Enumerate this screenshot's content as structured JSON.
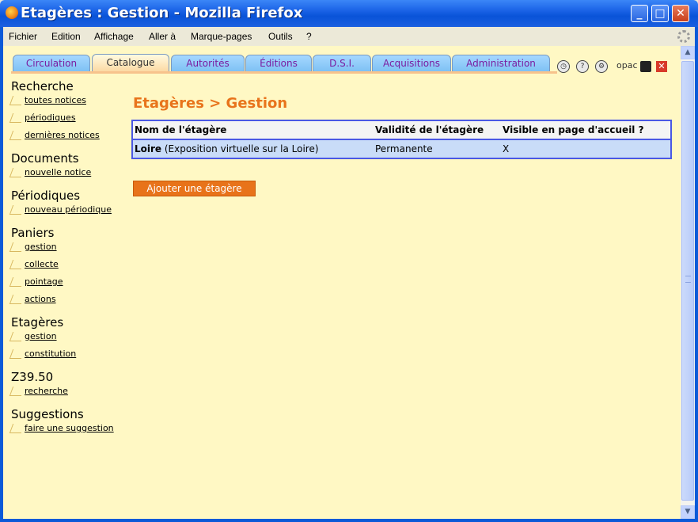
{
  "window": {
    "title": "Etagères : Gestion - Mozilla Firefox"
  },
  "menu": [
    "Fichier",
    "Edition",
    "Affichage",
    "Aller à",
    "Marque-pages",
    "Outils",
    "?"
  ],
  "tabs": [
    {
      "label": "Circulation"
    },
    {
      "label": "Catalogue"
    },
    {
      "label": "Autorités"
    },
    {
      "label": "Éditions"
    },
    {
      "label": "D.S.I."
    },
    {
      "label": "Acquisitions"
    },
    {
      "label": "Administration"
    }
  ],
  "toolbar": {
    "opac_label": "opac"
  },
  "sidebar": {
    "groups": [
      {
        "title": "Recherche",
        "links": [
          "toutes notices",
          "périodiques",
          "dernières notices"
        ]
      },
      {
        "title": "Documents",
        "links": [
          "nouvelle notice"
        ]
      },
      {
        "title": "Périodiques",
        "links": [
          "nouveau périodique"
        ]
      },
      {
        "title": "Paniers",
        "links": [
          "gestion",
          "collecte",
          "pointage",
          "actions"
        ]
      },
      {
        "title": "Etagères",
        "links": [
          "gestion",
          "constitution"
        ]
      },
      {
        "title": "Z39.50",
        "links": [
          "recherche"
        ]
      },
      {
        "title": "Suggestions",
        "links": [
          "faire une suggestion"
        ]
      }
    ]
  },
  "main": {
    "title": "Etagères > Gestion",
    "table": {
      "headers": [
        "Nom de l'étagère",
        "Validité de l'étagère",
        "Visible en page d'accueil ?"
      ],
      "rows": [
        {
          "name": "Loire",
          "description": " (Exposition virtuelle sur la Loire)",
          "validity": "Permanente",
          "visible": "X"
        }
      ]
    },
    "add_button": "Ajouter une étagère"
  }
}
